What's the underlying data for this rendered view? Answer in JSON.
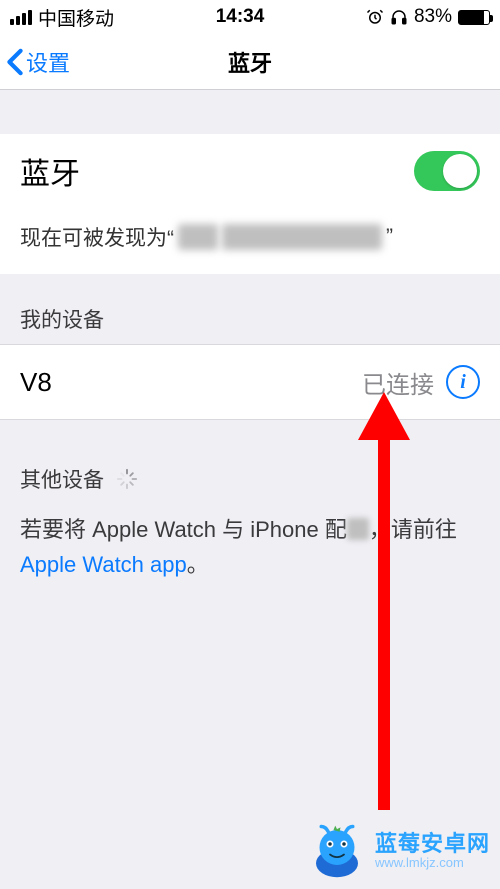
{
  "status_bar": {
    "carrier": "中国移动",
    "time": "14:34",
    "battery_percent": "83%",
    "battery_fill_pct": 83
  },
  "nav": {
    "back_label": "设置",
    "title": "蓝牙"
  },
  "bluetooth": {
    "label": "蓝牙",
    "discoverable_prefix": "现在可被发现为“",
    "discoverable_suffix": "”"
  },
  "my_devices": {
    "header": "我的设备",
    "items": [
      {
        "name": "V8",
        "status": "已连接"
      }
    ]
  },
  "other_devices": {
    "header": "其他设备"
  },
  "footer": {
    "part1": "若要将 Apple Watch 与 iPhone 配",
    "part2": "，请前往 ",
    "link": "Apple Watch app",
    "part3": "。"
  },
  "watermark": {
    "title": "蓝莓安卓网",
    "url": "www.lmkjz.com"
  },
  "colors": {
    "ios_blue": "#0a7aff",
    "ios_green": "#34c759",
    "arrow_red": "#ff0000"
  }
}
